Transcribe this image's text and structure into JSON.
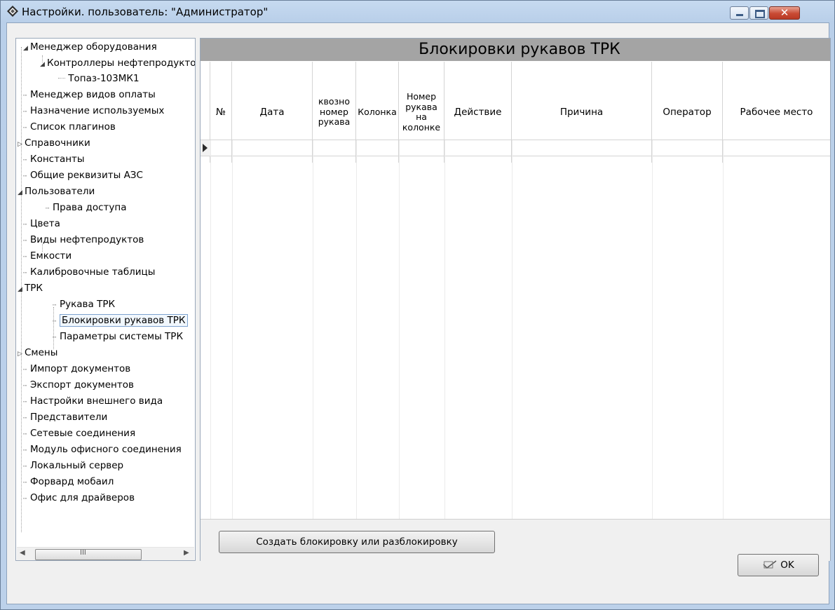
{
  "window": {
    "title": "Настройки. пользователь: \"Администратор\"",
    "close_label": "✕"
  },
  "tree": {
    "items": [
      {
        "label": "Менеджер оборудования",
        "expander": "◢"
      },
      {
        "label": "Контроллеры нефтепродуктов",
        "expander": "◢"
      },
      {
        "label": "Топаз-103МК1"
      },
      {
        "label": "Менеджер видов оплаты"
      },
      {
        "label": "Назначение используемых"
      },
      {
        "label": "Список плагинов"
      },
      {
        "label": "Справочники",
        "expander": "▷"
      },
      {
        "label": "Константы"
      },
      {
        "label": "Общие реквизиты АЗС"
      },
      {
        "label": "Пользователи",
        "expander": "◢"
      },
      {
        "label": "Права доступа"
      },
      {
        "label": "Цвета"
      },
      {
        "label": "Виды нефтепродуктов"
      },
      {
        "label": "Емкости"
      },
      {
        "label": "Калибровочные таблицы"
      },
      {
        "label": "ТРК",
        "expander": "◢"
      },
      {
        "label": "Рукава ТРК"
      },
      {
        "label": "Блокировки рукавов ТРК"
      },
      {
        "label": "Параметры системы ТРК"
      },
      {
        "label": "Смены",
        "expander": "▷"
      },
      {
        "label": "Импорт документов"
      },
      {
        "label": "Экспорт документов"
      },
      {
        "label": "Настройки внешнего вида"
      },
      {
        "label": "Представители"
      },
      {
        "label": "Сетевые соединения"
      },
      {
        "label": "Модуль офисного соединения"
      },
      {
        "label": "Локальный сервер"
      },
      {
        "label": "Форвард мобаил"
      },
      {
        "label": "Офис для драйверов"
      }
    ],
    "scroll_thumb_label": "III"
  },
  "grid": {
    "title": "Блокировки рукавов ТРК",
    "columns": [
      "№",
      "Дата",
      "квозно номер рукава",
      "Колонка",
      "Номер рукава на колонке",
      "Действие",
      "Причина",
      "Оператор",
      "Рабочее место"
    ]
  },
  "buttons": {
    "create": "Создать блокировку или разблокировку",
    "ok": "OK"
  }
}
